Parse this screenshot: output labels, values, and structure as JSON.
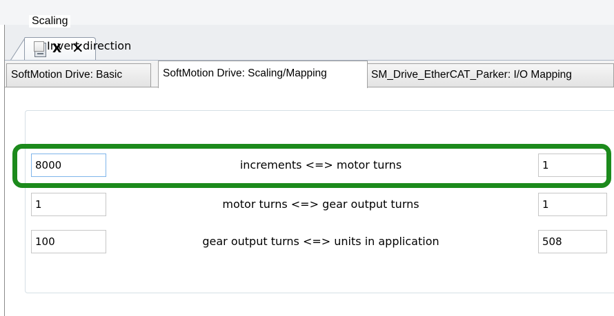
{
  "editor_tab": {
    "title": "X",
    "close_glyph": "✕"
  },
  "subtabs": [
    {
      "label": "SoftMotion Drive: Basic",
      "active": false
    },
    {
      "label": "SoftMotion Drive: Scaling/Mapping",
      "active": true
    },
    {
      "label": "SM_Drive_EtherCAT_Parker: I/O Mapping",
      "active": false
    }
  ],
  "scaling": {
    "group_title": "Scaling",
    "invert_direction": {
      "label": "Invert direction",
      "checked": false
    },
    "rows": [
      {
        "left_value": "8000",
        "label": "increments <=> motor turns",
        "right_value": "1"
      },
      {
        "left_value": "1",
        "label": "motor turns <=> gear output turns",
        "right_value": "1"
      },
      {
        "left_value": "100",
        "label": "gear output turns <=> units in application",
        "right_value": "508"
      }
    ]
  },
  "colors": {
    "highlight": "#1c8a1c",
    "focus_border": "#7eb4ea"
  },
  "icons": {
    "editor_tab": "device-document-icon"
  }
}
